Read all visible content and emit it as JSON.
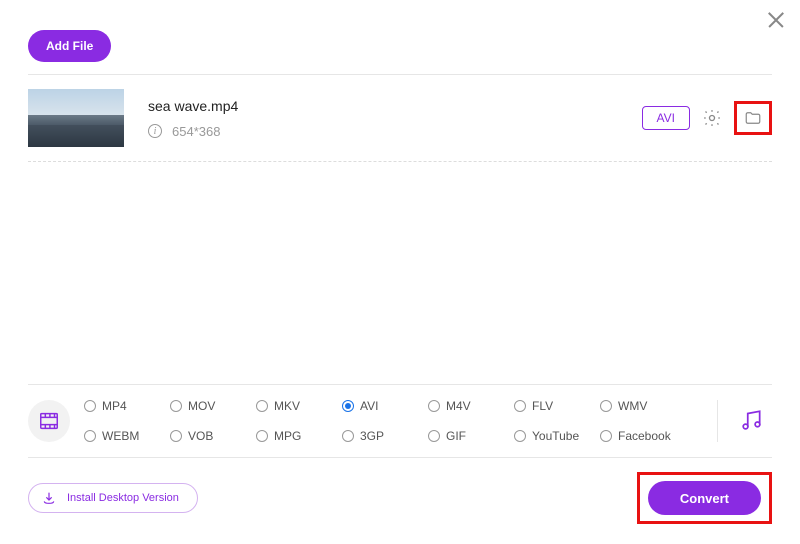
{
  "colors": {
    "accent": "#8a2be2",
    "highlight": "#e81212"
  },
  "header": {
    "add_file_label": "Add File"
  },
  "file": {
    "name": "sea wave.mp4",
    "resolution": "654*368",
    "output_format": "AVI"
  },
  "formats": {
    "items": [
      {
        "label": "MP4",
        "checked": false
      },
      {
        "label": "MOV",
        "checked": false
      },
      {
        "label": "MKV",
        "checked": false
      },
      {
        "label": "AVI",
        "checked": true
      },
      {
        "label": "M4V",
        "checked": false
      },
      {
        "label": "FLV",
        "checked": false
      },
      {
        "label": "WMV",
        "checked": false
      },
      {
        "label": "WEBM",
        "checked": false
      },
      {
        "label": "VOB",
        "checked": false
      },
      {
        "label": "MPG",
        "checked": false
      },
      {
        "label": "3GP",
        "checked": false
      },
      {
        "label": "GIF",
        "checked": false
      },
      {
        "label": "YouTube",
        "checked": false
      },
      {
        "label": "Facebook",
        "checked": false
      }
    ]
  },
  "footer": {
    "install_label": "Install Desktop Version",
    "convert_label": "Convert"
  }
}
